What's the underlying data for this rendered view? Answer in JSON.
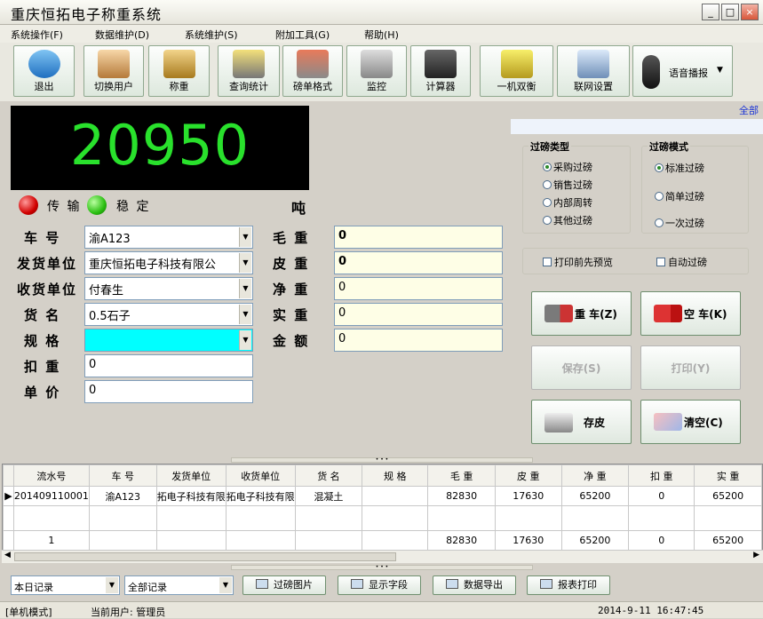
{
  "window": {
    "title": "重庆恒拓电子称重系统"
  },
  "menu": [
    "系统操作(F)",
    "数据维护(D)",
    "系统维护(S)",
    "附加工具(G)",
    "帮助(H)"
  ],
  "toolbar": {
    "exit": "退出",
    "switch_user": "切换用户",
    "weigh": "称重",
    "query": "查询统计",
    "ticket_format": "磅单格式",
    "monitor": "监控",
    "calculator": "计算器",
    "dual": "一机双衡",
    "network": "联网设置",
    "voice": "语音播报"
  },
  "top_link": "全部",
  "display": {
    "weight": "20950",
    "unit": "吨"
  },
  "indicators": {
    "transmit": "传 输",
    "stable": "稳 定"
  },
  "form": {
    "plate_label": "车 号",
    "plate": "渝A123",
    "shipper_label": "发货单位",
    "shipper": "重庆恒拓电子科技有限公",
    "receiver_label": "收货单位",
    "receiver": "付春生",
    "goods_label": "货 名",
    "goods": "0.5石子",
    "spec_label": "规 格",
    "spec": "",
    "deduct_label": "扣 重",
    "deduct": "0",
    "price_label": "单 价",
    "price": "0",
    "gross_label": "毛 重",
    "gross": "0",
    "tare_label": "皮 重",
    "tare": "0",
    "net_label": "净 重",
    "net": "0",
    "actual_label": "实 重",
    "actual": "0",
    "amount_label": "金 额",
    "amount": "0"
  },
  "weigh_type": {
    "title": "过磅类型",
    "options": [
      "采购过磅",
      "销售过磅",
      "内部周转",
      "其他过磅"
    ],
    "selected": 0
  },
  "weigh_mode": {
    "title": "过磅模式",
    "options": [
      "标准过磅",
      "简单过磅",
      "一次过磅"
    ],
    "selected": 0
  },
  "checks": {
    "preview": "打印前先预览",
    "auto": "自动过磅"
  },
  "buttons": {
    "heavy": "重 车(Z)",
    "empty": "空 车(K)",
    "save": "保存(S)",
    "print": "打印(Y)",
    "store_tare": "存皮",
    "clear": "清空(C)"
  },
  "table": {
    "headers": [
      "流水号",
      "车 号",
      "发货单位",
      "收货单位",
      "货 名",
      "规 格",
      "毛 重",
      "皮 重",
      "净 重",
      "扣 重",
      "实 重"
    ],
    "rows": [
      [
        "201409110001",
        "渝A123",
        "拓电子科技有限",
        "拓电子科技有限",
        "混凝土",
        "",
        "82830",
        "17630",
        "65200",
        "0",
        "65200"
      ]
    ],
    "footer": [
      "1",
      "",
      "",
      "",
      "",
      "",
      "82830",
      "17630",
      "65200",
      "0",
      "65200"
    ]
  },
  "bottom": {
    "range": "本日记录",
    "filter": "全部记录",
    "pics": "过磅图片",
    "fields": "显示字段",
    "export": "数据导出",
    "report": "报表打印"
  },
  "status": {
    "mode": "[单机模式]",
    "user": "当前用户: 管理员",
    "time": "2014-9-11  16:47:45"
  }
}
